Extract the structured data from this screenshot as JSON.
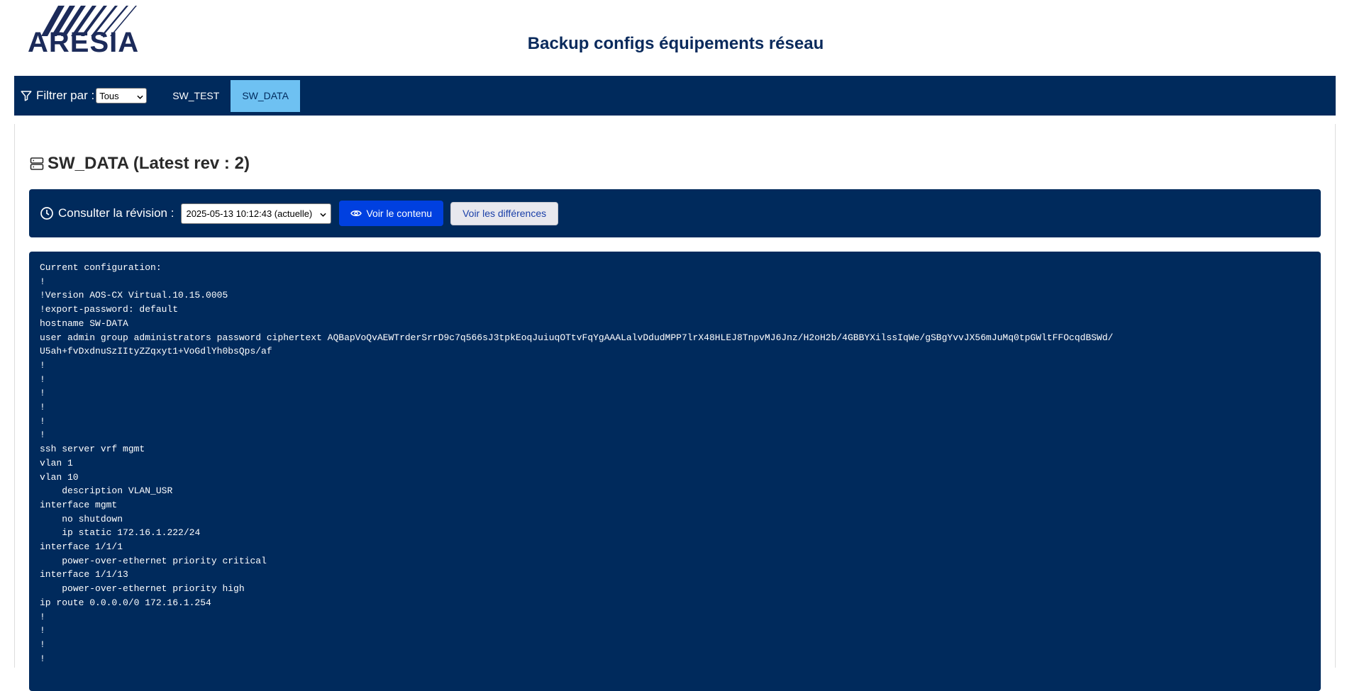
{
  "header": {
    "logo_text": "ARESIA",
    "title": "Backup configs équipements réseau"
  },
  "navbar": {
    "filter_label": "Filtrer par :",
    "filter_value": "Tous",
    "tabs": [
      {
        "label": "SW_TEST",
        "active": false
      },
      {
        "label": "SW_DATA",
        "active": true
      }
    ]
  },
  "device": {
    "title": "SW_DATA (Latest rev : 2)"
  },
  "revision": {
    "label": "Consulter la révision :",
    "selected": "2025-05-13 10:12:43 (actuelle)",
    "view_button": "Voir le contenu",
    "diff_button": "Voir les différences"
  },
  "config": {
    "content": "Current configuration:\n!\n!Version AOS-CX Virtual.10.15.0005\n!export-password: default\nhostname SW-DATA\nuser admin group administrators password ciphertext AQBapVoQvAEWTrderSrrD9c7q566sJ3tpkEoqJuiuqOTtvFqYgAAALalvDdudMPP7lrX48HLEJ8TnpvMJ6Jnz/H2oH2b/4GBBYXilssIqWe/gSBgYvvJX56mJuMq0tpGWltFFOcqdBSWd/\nU5ah+fvDxdnuSzIItyZZqxyt1+VoGdlYh0bsQps/af\n!\n!\n!\n!\n!\n!\nssh server vrf mgmt\nvlan 1\nvlan 10\n    description VLAN_USR\ninterface mgmt\n    no shutdown\n    ip static 172.16.1.222/24\ninterface 1/1/1\n    power-over-ethernet priority critical\ninterface 1/1/13\n    power-over-ethernet priority high\nip route 0.0.0.0/0 172.16.1.254\n!\n!\n!\n!"
  },
  "colors": {
    "navy": "#002a5c",
    "active_tab": "#6ec1f2",
    "primary_button": "#0040e0",
    "title_blue": "#0a2a5c"
  }
}
